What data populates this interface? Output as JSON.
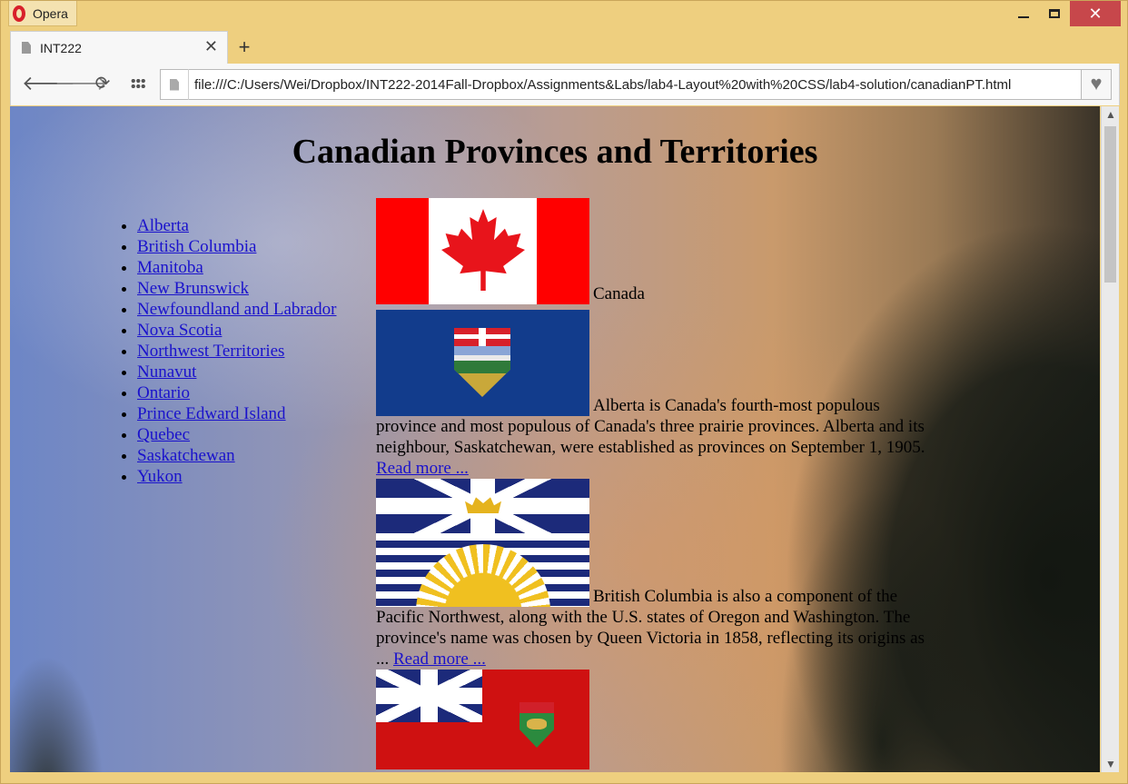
{
  "browser": {
    "app_name": "Opera",
    "tab_title": "INT222",
    "tab_close": "✕",
    "new_tab": "+",
    "url": "file:///C:/Users/Wei/Dropbox/INT222-2014Fall-Dropbox/Assignments&Labs/lab4-Layout%20with%20CSS/lab4-solution/canadianPT.html",
    "window_controls": {
      "close": "✕"
    }
  },
  "page": {
    "title": "Canadian Provinces and Territories",
    "provinces": [
      "Alberta",
      "British Columbia",
      "Manitoba",
      "New Brunswick",
      "Newfoundland and Labrador",
      "Nova Scotia",
      "Northwest Territories",
      "Nunavut",
      "Ontario",
      "Prince Edward Island",
      "Quebec",
      "Saskatchewan",
      "Yukon"
    ],
    "entries": {
      "canada": {
        "text": "Canada"
      },
      "alberta": {
        "text": "Alberta is Canada's fourth-most populous province and most populous of Canada's three prairie provinces. Alberta and its neighbour, Saskatchewan, were established as provinces on September 1, 1905.",
        "link": "Read more ..."
      },
      "bc": {
        "text": "British Columbia is also a component of the Pacific Northwest, along with the U.S. states of Oregon and Washington. The province's name was chosen by Queen Victoria in 1858, reflecting its origins as ...",
        "link": "Read more ..."
      }
    }
  },
  "colors": {
    "link": "#1a12cc",
    "close_button": "#c7474b",
    "frame": "#eecf7f"
  },
  "icons": [
    "opera-logo-icon",
    "minimize-icon",
    "maximize-icon",
    "close-icon",
    "document-icon",
    "back-icon",
    "forward-icon",
    "reload-icon",
    "speed-dial-icon",
    "heart-icon",
    "scroll-up-icon",
    "scroll-down-icon"
  ]
}
